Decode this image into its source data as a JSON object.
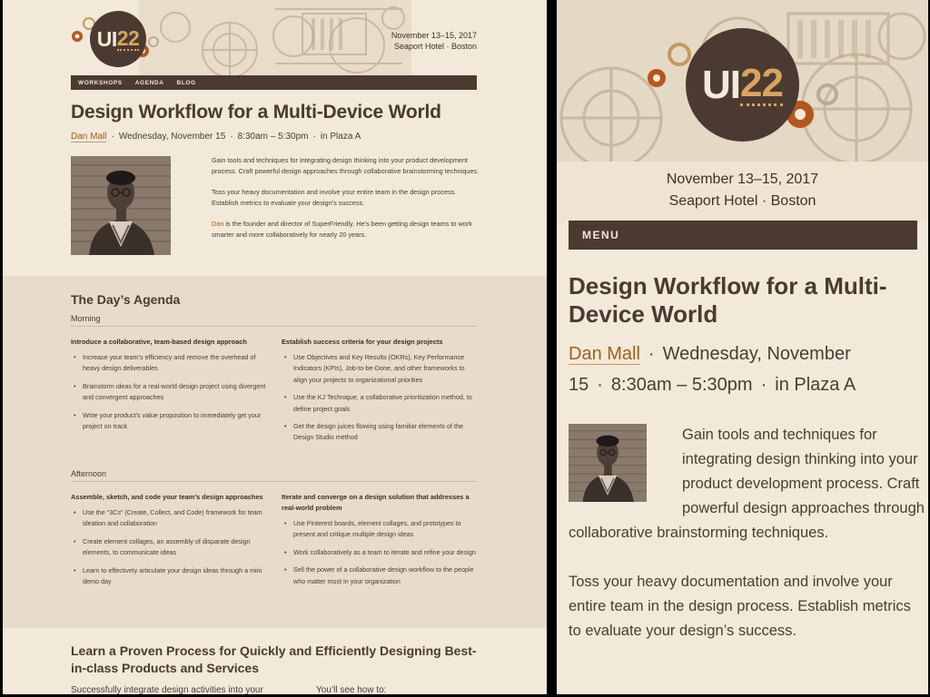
{
  "conference": {
    "logo_ui": "UI",
    "logo_year": "22",
    "date": "November 13–15, 2017",
    "venue": "Seaport Hotel · Boston"
  },
  "nav": {
    "items": [
      "WORKSHOPS",
      "AGENDA",
      "BLOG"
    ],
    "mobile_menu": "MENU"
  },
  "workshop": {
    "title": "Design Workflow for a Multi-Device World",
    "speaker": "Dan Mall",
    "date": "Wednesday, November 15",
    "time": "8:30am – 5:30pm",
    "location": "in Plaza A",
    "intro_1": "Gain tools and techniques for integrating design thinking into your product development process. Craft powerful design approaches through collaborative brainstorming techniques.",
    "intro_2": "Toss your heavy documentation and involve your entire team in the design process. Establish metrics to evaluate your design’s success.",
    "bio_name": "Dan",
    "bio_rest": " is the founder and director of SuperFriendly. He’s been getting design teams to work smarter and more collaboratively for nearly 20 years."
  },
  "agenda": {
    "title": "The Day’s Agenda",
    "morning_label": "Morning",
    "afternoon_label": "Afternoon",
    "morning": [
      {
        "heading": "Introduce a collaborative, team-based design approach",
        "items": [
          "Increase your team’s efficiency and remove the overhead of heavy design deliverables",
          "Brainstorm ideas for a real-world design project using divergent and convergent approaches",
          "Write your product’s value proposition to immediately get your project on track"
        ]
      },
      {
        "heading": "Establish success criteria for your design projects",
        "items": [
          "Use Objectives and Key Results (OKRs), Key Performance Indicators (KPIs), Job-to-be-Done, and other frameworks to align your projects to organizational priorities",
          "Use the KJ Technique, a collaborative prioritization method, to define project goals",
          "Get the design juices flowing using familiar elements of the Design Studio method"
        ]
      }
    ],
    "afternoon": [
      {
        "heading": "Assemble, sketch, and code your team’s design approaches",
        "items": [
          "Use the “3Cs” (Create, Collect, and Code) framework for team ideation and collaboration",
          "Create element collages, an assembly of disparate design elements, to communicate ideas",
          "Learn to effectively articulate your design ideas through a mini demo day"
        ]
      },
      {
        "heading": "Iterate and converge on a design solution that addresses a real-world problem",
        "items": [
          "Use Pinterest boards, element collages, and prototypes to present and critique multiple design ideas",
          "Work collaboratively as a team to iterate and refine your design",
          "Sell the power of a collaborative design workflow to the people who matter most in your organization"
        ]
      }
    ]
  },
  "learn": {
    "title": "Learn a Proven Process for Quickly and Efficiently Designing Best-in-class Products and Services",
    "sub_left": "Successfully integrate design activities into your",
    "sub_right": "You’ll see how to:"
  },
  "colors": {
    "background": "#f2e9d8",
    "dark_brown": "#4b3a31",
    "accent_gold": "#d9a45d",
    "link_brown": "#a0601d",
    "agenda_bg": "#e6dcc9"
  }
}
